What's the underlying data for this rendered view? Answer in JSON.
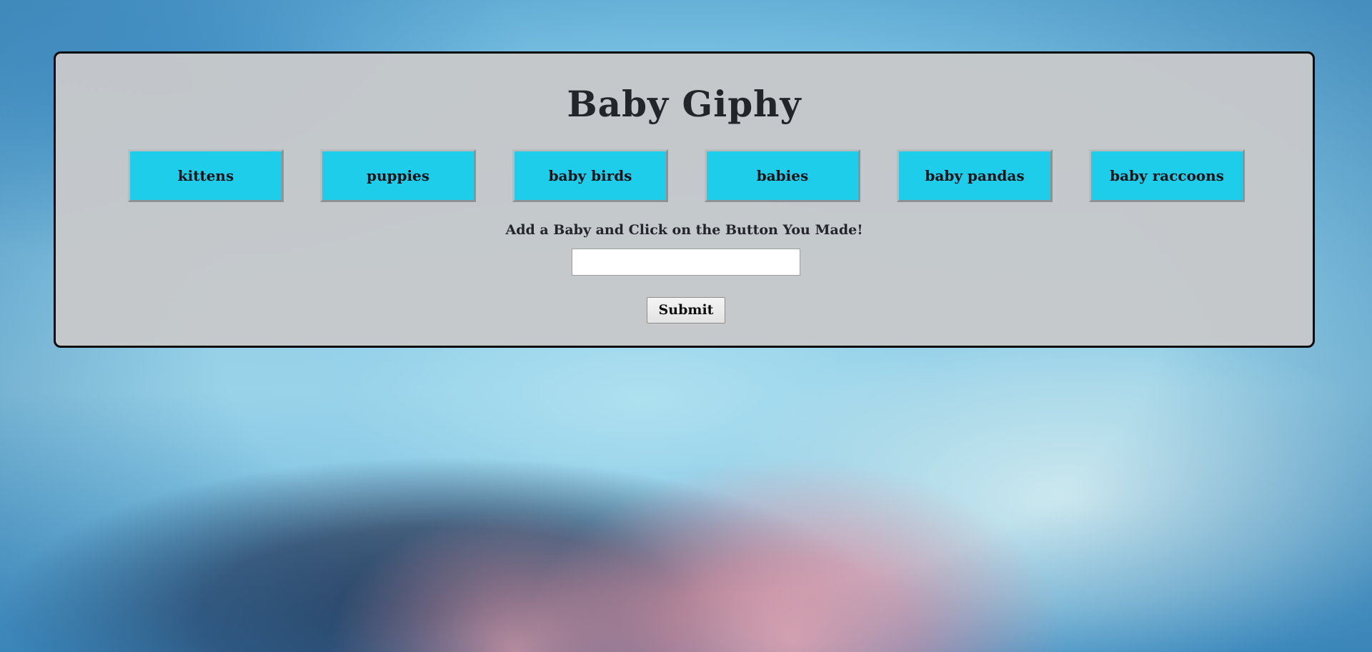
{
  "page": {
    "title": "Baby Giphy"
  },
  "topics": [
    {
      "label": "kittens"
    },
    {
      "label": "puppies"
    },
    {
      "label": "baby birds"
    },
    {
      "label": "babies"
    },
    {
      "label": "baby pandas"
    },
    {
      "label": "baby raccoons"
    }
  ],
  "form": {
    "prompt": "Add a Baby and Click on the Button You Made!",
    "input_value": "",
    "input_placeholder": "",
    "submit_label": "Submit"
  },
  "colors": {
    "topic_button": "#1ecde9",
    "panel": "#c6c8ca",
    "panel_border": "#0b0b0b",
    "text": "#22262a"
  }
}
